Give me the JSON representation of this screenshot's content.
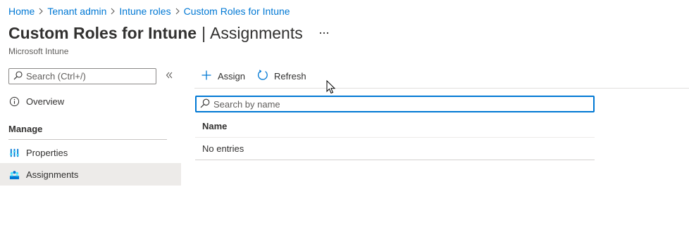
{
  "breadcrumb": {
    "items": [
      "Home",
      "Tenant admin",
      "Intune roles",
      "Custom Roles for Intune"
    ]
  },
  "header": {
    "title": "Custom Roles for Intune",
    "separator": "|",
    "page": "Assignments",
    "subtitle": "Microsoft Intune"
  },
  "sidebar": {
    "search_placeholder": "Search (Ctrl+/)",
    "overview_label": "Overview",
    "section_manage": "Manage",
    "items": [
      {
        "label": "Properties",
        "icon": "properties-icon"
      },
      {
        "label": "Assignments",
        "icon": "assignments-icon",
        "selected": true
      }
    ]
  },
  "toolbar": {
    "assign_label": "Assign",
    "refresh_label": "Refresh"
  },
  "main": {
    "search_placeholder": "Search by name",
    "columns": [
      "Name"
    ],
    "empty_text": "No entries"
  },
  "colors": {
    "accent": "#0078d4",
    "selected_bg": "#edebe9",
    "text": "#323130"
  }
}
